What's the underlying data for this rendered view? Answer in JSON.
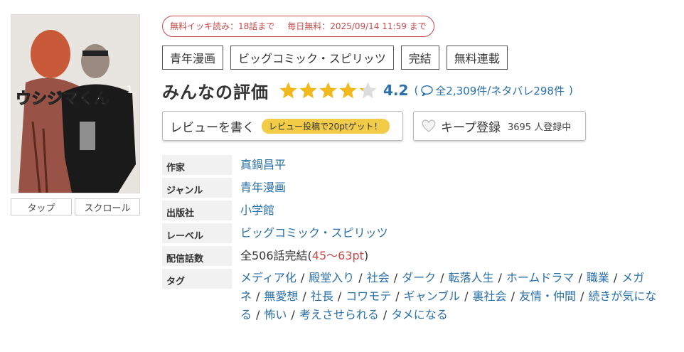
{
  "cover": {
    "buttons": [
      "タップ",
      "スクロール"
    ]
  },
  "free_badge": {
    "free_read": "無料イッキ読み：18話まで",
    "daily_free": "毎日無料：2025/09/14 11:59 まで"
  },
  "genres": [
    "青年漫画",
    "ビッグコミック・スピリッツ",
    "完結",
    "無料連載"
  ],
  "rating": {
    "title": "みんなの評価",
    "stars_value": 4.2,
    "score": "4.2",
    "open_paren": "(",
    "total": "全2,309件",
    "slash": "/",
    "spoilers": "ネタバレ298件",
    "close_paren": ")",
    "star_color": "#f2b91e",
    "star_empty_color": "#dddddd"
  },
  "actions": {
    "review_label": "レビューを書く",
    "review_promo": "レビュー投稿で20ptゲット！",
    "keep_label": "キープ登録",
    "keep_count": "3695 人登録中"
  },
  "info": {
    "author_label": "作家",
    "author": "真鍋昌平",
    "genre_label": "ジャンル",
    "genre": "青年漫画",
    "publisher_label": "出版社",
    "publisher": "小学館",
    "label_label": "レーベル",
    "label": "ビッグコミック・スピリッツ",
    "episodes_label": "配信話数",
    "episodes": "全506話完結(",
    "price": "45〜63pt",
    "episodes_close": ")",
    "tags_label": "タグ",
    "tags": [
      "メディア化",
      "殿堂入り",
      "社会",
      "ダーク",
      "転落人生",
      "ホームドラマ",
      "職業",
      "メガネ",
      "無愛想",
      "社長",
      "コワモテ",
      "ギャンブル",
      "裏社会",
      "友情・仲間",
      "続きが気になる",
      "怖い",
      "考えさせられる",
      "タメになる"
    ]
  }
}
